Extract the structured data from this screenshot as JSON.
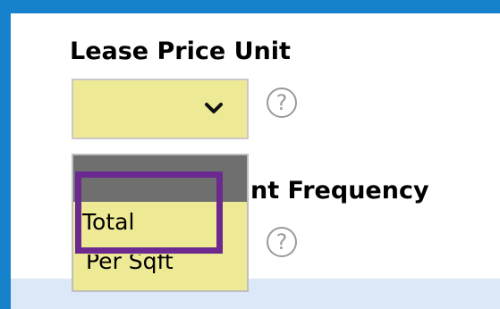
{
  "form": {
    "lease_price_unit_label": "Lease Price Unit",
    "payment_frequency_label_visible": "nt Frequency"
  },
  "select": {
    "current_value": "",
    "options": [
      "",
      "Total",
      "Per Sqft"
    ],
    "highlighted_option": "Total"
  },
  "icons": {
    "help": "question-mark-circle-icon",
    "help_glyph": "?",
    "chevron": "chevron-down-icon"
  },
  "colors": {
    "frame_blue": "#1682cc",
    "select_bg": "#ede994",
    "highlight": "#6c2a91",
    "blank_option": "#6f6f6f"
  }
}
